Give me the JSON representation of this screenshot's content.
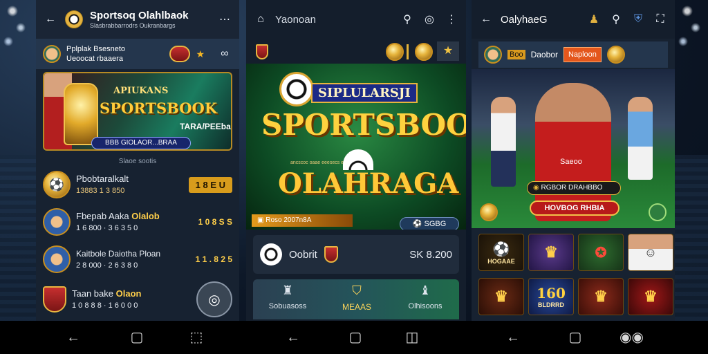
{
  "panel1": {
    "title": "Sportsoq Olahlbaok",
    "subtitle": "Slasbrabbarrodrs Oukranbargs",
    "menu_icon": "more-horizontal-icon",
    "account": {
      "line1": "Pplplak Bsesneto",
      "line2": "Ueoocat rbaaera"
    },
    "banner": {
      "top": "APIUKANS",
      "main": "SPORTSBOOK",
      "side": "TARA/PEEbaik",
      "button": "BBB GIOLAOR...BRAA"
    },
    "section_label": "Slaoe sootis",
    "matches": [
      {
        "name": "Pbobtaralkalt",
        "odds": "13883  1 3 850",
        "button": "1 8 E U"
      },
      {
        "name": "Fbepab Aaka",
        "tag": "Olalob",
        "odds": "1 6 800 · 3 6 3 5 0",
        "value": "1 0 8 S S"
      },
      {
        "name": "Kaitbole Daiotha Ploan",
        "odds": "2 8 000 · 2 6 3 8 0",
        "value": "1 1 . 8 2 5"
      },
      {
        "name": "Taan bake",
        "tag": "Olaon",
        "odds": "1 0 8 8 8 · 1 6 0 0 0"
      }
    ]
  },
  "panel2": {
    "title": "Yaonoan",
    "hero": {
      "top": "SIPLULARSJI",
      "main": "SPORTSBOOK",
      "bottom": "OLAHRAGA",
      "strip": "ancscoc oaae  eeesecs  esoebe  sesmn"
    },
    "promo": "Roso 2007n8A",
    "score": "SGBG",
    "match": {
      "name": "Oobrit",
      "value": "SK 8.200"
    },
    "tabs": [
      {
        "label": "Sobuasoss"
      },
      {
        "label": "MEAAS"
      },
      {
        "label": "Olhisoons"
      }
    ]
  },
  "panel3": {
    "title": "OalyhaeG",
    "user": {
      "badge": "Boo",
      "name": "Daobor",
      "button": "Naploon"
    },
    "hero": {
      "info": "RGBOR DRAHBBO",
      "button": "HOVBOG RHBIA",
      "player_badge": "Saeoo"
    },
    "games": [
      {
        "label": "HOGAAE"
      },
      {
        "label": ""
      },
      {
        "label": ""
      },
      {
        "label": ""
      },
      {
        "label": ""
      },
      {
        "label": "BLDRRD"
      },
      {
        "label": ""
      },
      {
        "label": ""
      }
    ],
    "game_center": "160"
  },
  "colors": {
    "accent": "#e4b33a",
    "panel": "#172231",
    "nav": "#000000",
    "tab_green": "#1f6b4a"
  }
}
